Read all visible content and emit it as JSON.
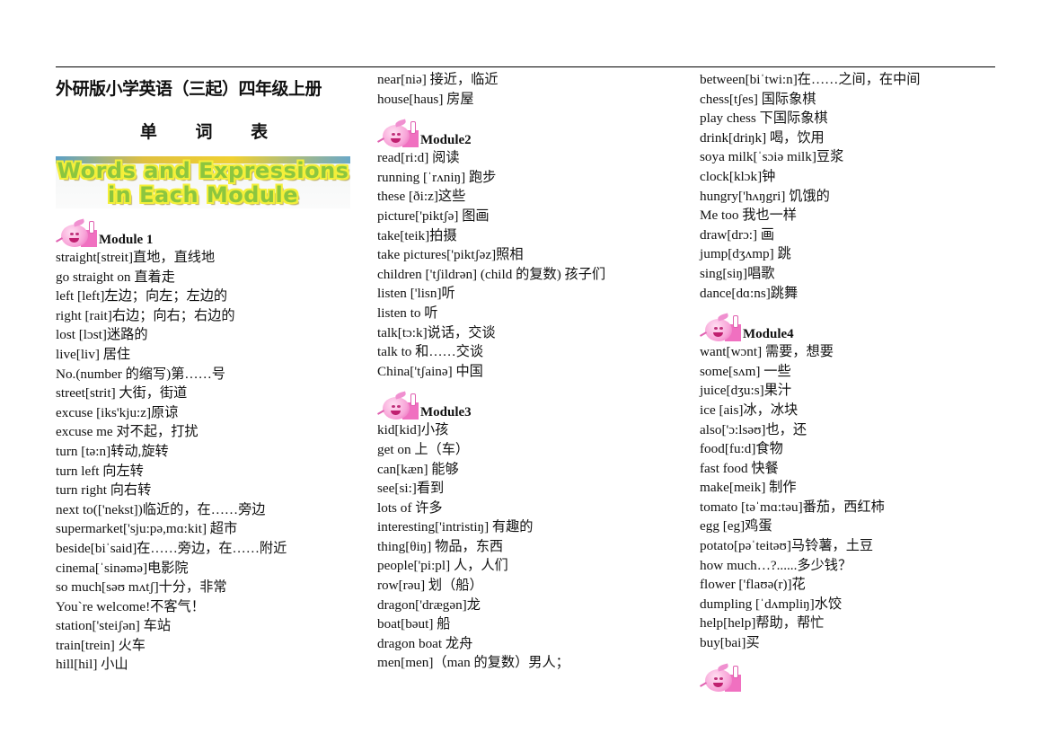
{
  "document": {
    "title": "外研版小学英语（三起）四年级上册",
    "subtitle": "单 词 表",
    "banner": {
      "line1": "Words and Expressions",
      "line2": "in Each Module"
    },
    "icon": "pink-apple-mascot-icon"
  },
  "columns": {
    "col1": {
      "modules": [
        {
          "name": "Module 1",
          "entries": [
            "straight[streit]直地，直线地",
            "go straight on  直着走",
            "left [left]左边；向左；左边的",
            "right [rait]右边；向右；右边的",
            "lost [lɔst]迷路的",
            "live[liv]  居住",
            "No.(number 的缩写)第……号",
            "street[strit]  大街，街道",
            "excuse [iks'kju:z]原谅",
            "excuse me 对不起，打扰",
            "turn [tə:n]转动,旋转",
            "turn left  向左转",
            "turn right  向右转",
            "next to(['nekst])临近的，在……旁边",
            "supermarket['sju:pə,mɑ:kit]  超市",
            "beside[biˈsaid]在……旁边，在……附近",
            "cinema[ˈsinəmə]电影院",
            "so much[səʊ mʌtʃ]十分，非常",
            "You`re welcome!不客气！",
            "station['steiʃən]  车站",
            "train[trein]  火车",
            "hill[hil]  小山"
          ]
        }
      ]
    },
    "col2": {
      "continued": [
        "near[niə]  接近，临近",
        "house[haus]  房屋"
      ],
      "modules": [
        {
          "name": "Module2",
          "entries": [
            "read[ri:d]  阅读",
            "running [ˈrʌniŋ]  跑步",
            "these [ði:z]这些",
            "picture['piktʃə]  图画",
            "take[teik]拍摄",
            "take pictures['piktʃəz]照相",
            "children ['tʃildrən] (child 的复数)  孩子们",
            "listen ['lisn]听",
            "listen to 听",
            "talk[tɔ:k]说话，交谈",
            "talk to  和……交谈",
            "China['tʃainə]  中国"
          ]
        },
        {
          "name": "Module3",
          "entries": [
            "kid[kid]小孩",
            "get on  上（车）",
            "can[kæn]  能够",
            "see[si:]看到",
            "lots of 许多",
            "interesting['intristiŋ]  有趣的",
            "thing[θiŋ]  物品，东西",
            "people['pi:pl]  人，人们",
            "row[rəu]  划（船）",
            "dragon['drægən]龙",
            "boat[bəut]  船",
            "dragon boat 龙舟",
            "men[men]（man 的复数）男人；"
          ]
        }
      ]
    },
    "col3": {
      "continued": [
        "between[biˈtwi:n]在……之间，在中间",
        "chess[tʃes]  国际象棋",
        "play chess 下国际象棋",
        "drink[driŋk]  喝，饮用",
        "soya milk[ˈsɔiə milk]豆浆",
        "clock[klɔk]钟",
        "hungry['hʌŋgri]  饥饿的",
        "Me too 我也一样",
        "draw[drɔ:]  画",
        "jump[dʒʌmp]  跳",
        "sing[siŋ]唱歌",
        "dance[dɑ:ns]跳舞"
      ],
      "modules": [
        {
          "name": "Module4",
          "entries": [
            "want[wɔnt]  需要，想要",
            "some[sʌm]  一些",
            "juice[dʒu:s]果汁",
            "ice [ais]冰，冰块",
            "also['ɔ:lsəʊ]也，还",
            "food[fu:d]食物",
            "fast food  快餐",
            "make[meik]  制作",
            "tomato [təˈmɑ:təu]番茄，西红柿",
            "egg [eg]鸡蛋",
            "potato[pəˈteitəʊ]马铃薯，土豆",
            "how much…?......多少钱？",
            "flower ['flaʊə(r)]花",
            "dumpling [ˈdʌmpliŋ]水饺",
            "help[help]帮助，帮忙",
            "buy[bai]买"
          ]
        }
      ]
    }
  }
}
